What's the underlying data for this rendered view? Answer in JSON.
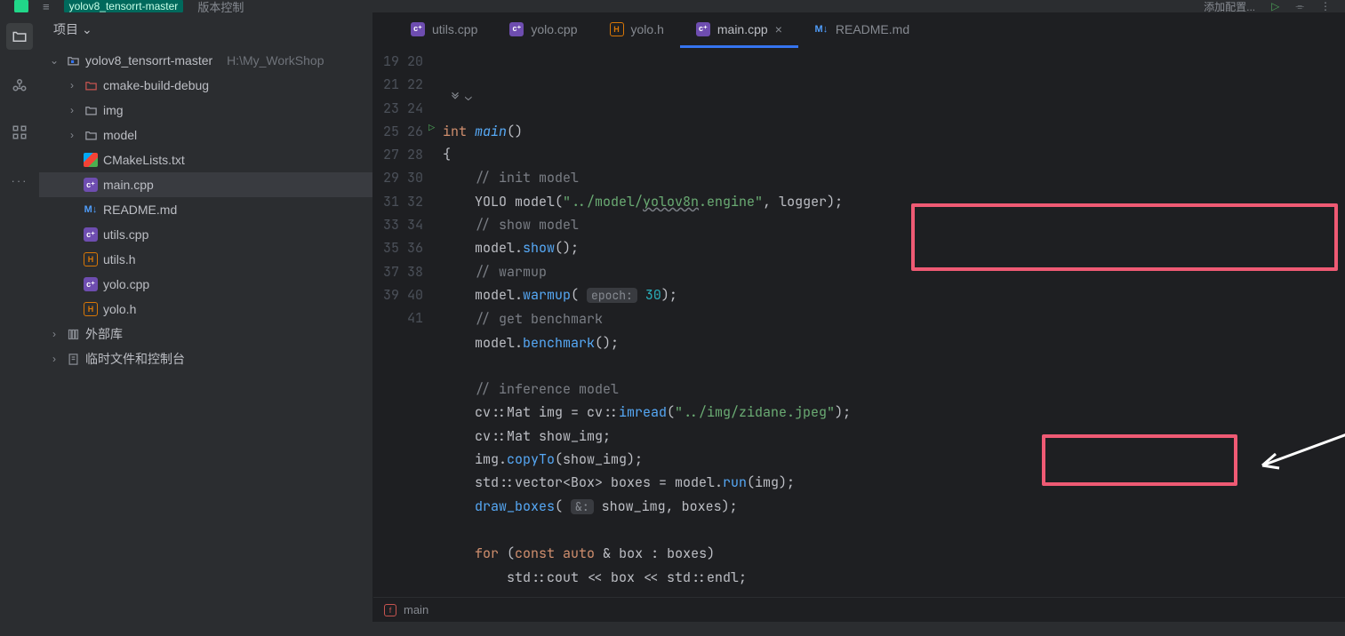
{
  "top": {
    "project": "yolov8_tensorrt-master",
    "menu": "版本控制",
    "launcher": "添加配置..."
  },
  "sidebarHeader": {
    "title": "项目"
  },
  "tree": {
    "root": {
      "name": "yolov8_tensorrt-master",
      "hint": "H:\\My_WorkShop"
    },
    "folders": {
      "build": "cmake-build-debug",
      "img": "img",
      "model": "model"
    },
    "files": {
      "cmakelists": "CMakeLists.txt",
      "main": "main.cpp",
      "readme": "README.md",
      "utils_cpp": "utils.cpp",
      "utils_h": "utils.h",
      "yolo_cpp": "yolo.cpp",
      "yolo_h": "yolo.h"
    },
    "extra": {
      "external": "外部库",
      "temp": "临时文件和控制台"
    }
  },
  "tabs": [
    {
      "icon": "cpp",
      "label": "utils.cpp"
    },
    {
      "icon": "cpp",
      "label": "yolo.cpp"
    },
    {
      "icon": "h",
      "label": "yolo.h"
    },
    {
      "icon": "cpp",
      "label": "main.cpp",
      "active": true,
      "closeable": true
    },
    {
      "icon": "md",
      "label": "README.md"
    }
  ],
  "code": {
    "first_line": 19,
    "lines": [
      "",
      "",
      "",
      "int main()",
      "{",
      "    // init model",
      "    YOLO model(\"../model/yolov8n.engine\", logger);",
      "    // show model",
      "    model.show();",
      "    // warmup",
      "    model.warmup( epoch: 30);",
      "    // get benchmark",
      "    model.benchmark();",
      "",
      "    // inference model",
      "    cv::Mat img = cv::imread(\"../img/zidane.jpeg\");",
      "    cv::Mat show_img;",
      "    img.copyTo(show_img);",
      "    std::vector<Box> boxes = model.run(img);",
      "    draw_boxes( &: show_img, boxes);",
      "",
      "    for (const auto & box : boxes)",
      "        std::cout << box << std::endl;",
      ""
    ],
    "hints": {
      "epoch": "epoch:",
      "amp": "&:"
    }
  },
  "breadcrumb": {
    "fn": "main"
  }
}
